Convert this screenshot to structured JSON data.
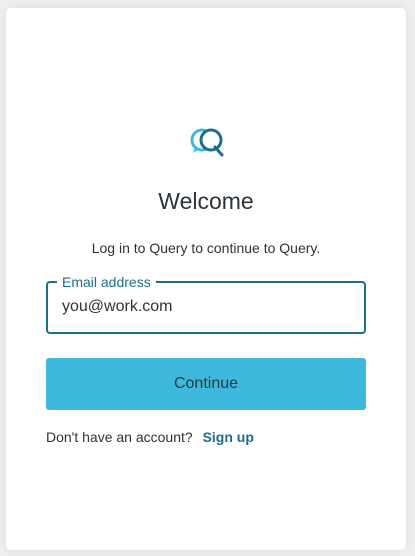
{
  "brand": {
    "logo_icon": "query-chat-bubble-logo-icon",
    "logo_colors": {
      "primary": "#1f6e88",
      "secondary": "#3eb8dd"
    }
  },
  "header": {
    "title": "Welcome",
    "subtitle": "Log in to Query to continue to Query."
  },
  "form": {
    "email_label": "Email address",
    "email_value": "you@work.com",
    "continue_label": "Continue"
  },
  "footer": {
    "prompt": "Don't have an account?",
    "signup_label": "Sign up"
  },
  "colors": {
    "accent": "#1f6e88",
    "button_bg": "#3eb8dd"
  }
}
